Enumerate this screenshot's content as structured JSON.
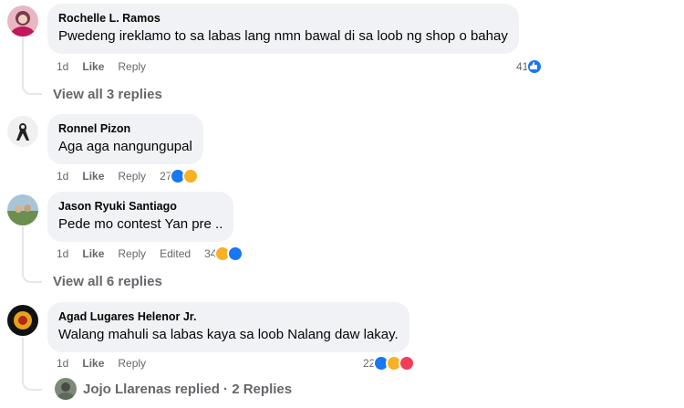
{
  "comments": [
    {
      "author": "Rochelle L. Ramos",
      "text": "Pwedeng ireklamo to sa labas lang nmn bawal di sa loob ng shop o bahay",
      "time": "1d",
      "like_label": "Like",
      "reply_label": "Reply",
      "reaction_count": "41",
      "reactions": [
        "like-icon"
      ],
      "view_replies": "View all 3 replies"
    },
    {
      "author": "Ronnel Pizon",
      "text": "Aga aga nangungupal",
      "time": "1d",
      "like_label": "Like",
      "reply_label": "Reply",
      "reaction_count": "27",
      "reactions": [
        "like-icon",
        "haha-icon"
      ]
    },
    {
      "author": "Jason Ryuki Santiago",
      "text": "Pede mo contest Yan pre ..",
      "time": "1d",
      "like_label": "Like",
      "reply_label": "Reply",
      "edited_label": "Edited",
      "reaction_count": "34",
      "reactions": [
        "haha-icon",
        "like-icon"
      ],
      "view_replies": "View all 6 replies"
    },
    {
      "author": "Agad Lugares Helenor Jr.",
      "text": "Walang mahuli sa labas kaya sa loob Nalang daw lakay.",
      "time": "1d",
      "like_label": "Like",
      "reply_label": "Reply",
      "reaction_count": "22",
      "reactions": [
        "like-icon",
        "haha-icon",
        "love-icon"
      ],
      "replied_name": "Jojo Llarenas",
      "replied_suffix": "replied · 2 Replies"
    }
  ],
  "colors": {
    "bubble": "#f0f2f5",
    "secondary_text": "#65676b",
    "like": "#1877f2",
    "haha": "#f7b125",
    "love": "#f33e58"
  }
}
